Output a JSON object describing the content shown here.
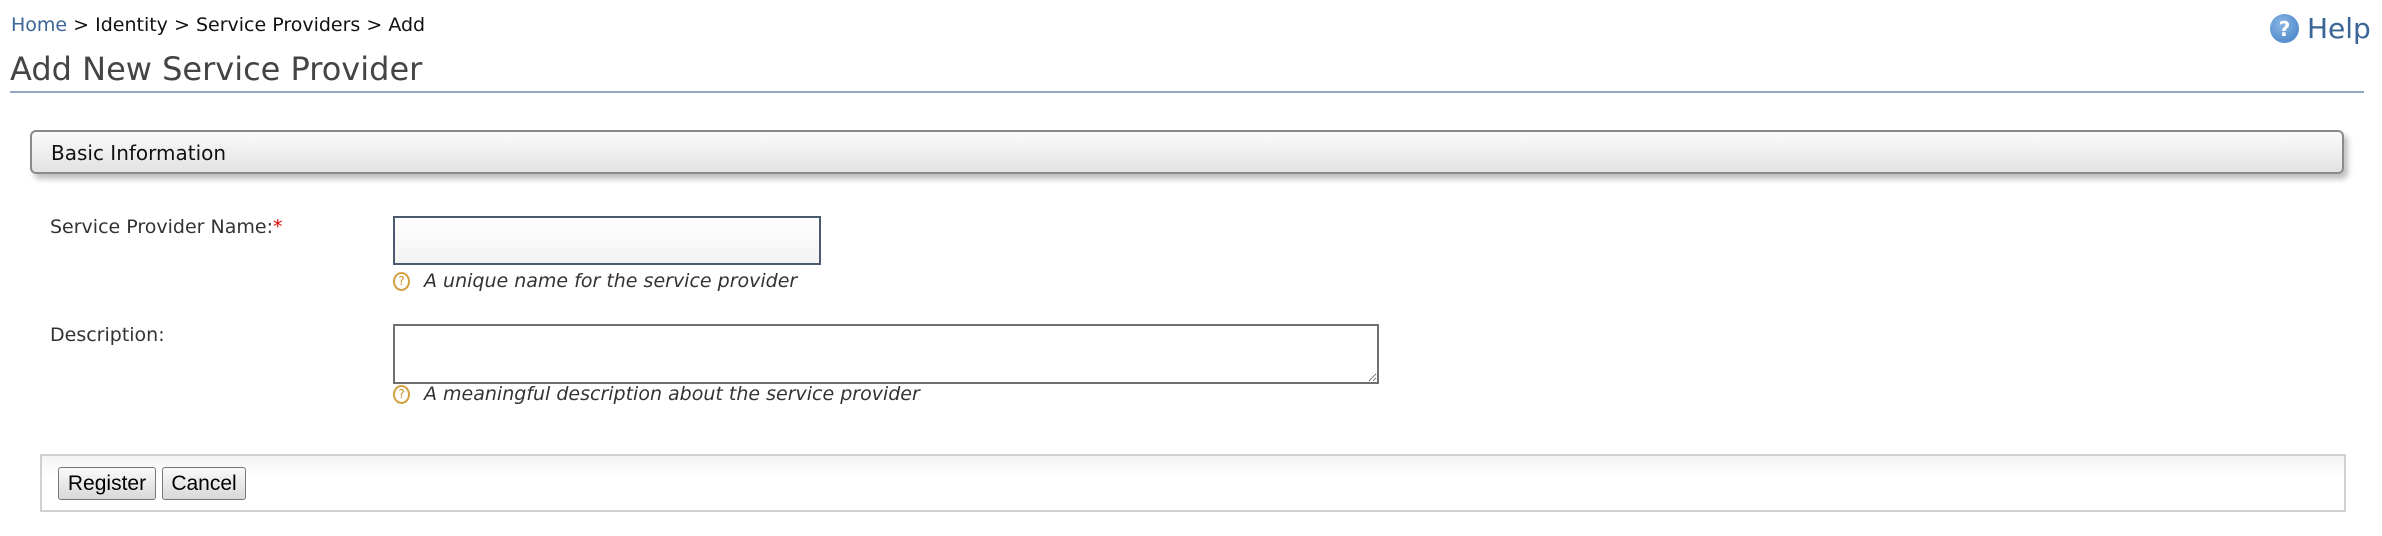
{
  "breadcrumb": {
    "home": "Home",
    "sep": " > ",
    "items": [
      "Identity",
      "Service Providers",
      "Add"
    ]
  },
  "help": {
    "icon": "help-circle-icon",
    "label": "Help",
    "glyph": "?"
  },
  "page_title": "Add New Service Provider",
  "section": {
    "title": "Basic Information"
  },
  "form": {
    "name": {
      "label": "Service Provider Name:",
      "required_mark": "*",
      "value": "",
      "hint": "A unique name for the service provider"
    },
    "description": {
      "label": "Description:",
      "value": "",
      "hint": "A meaningful description about the service provider"
    },
    "hint_glyph": "?"
  },
  "buttons": {
    "register": "Register",
    "cancel": "Cancel"
  }
}
